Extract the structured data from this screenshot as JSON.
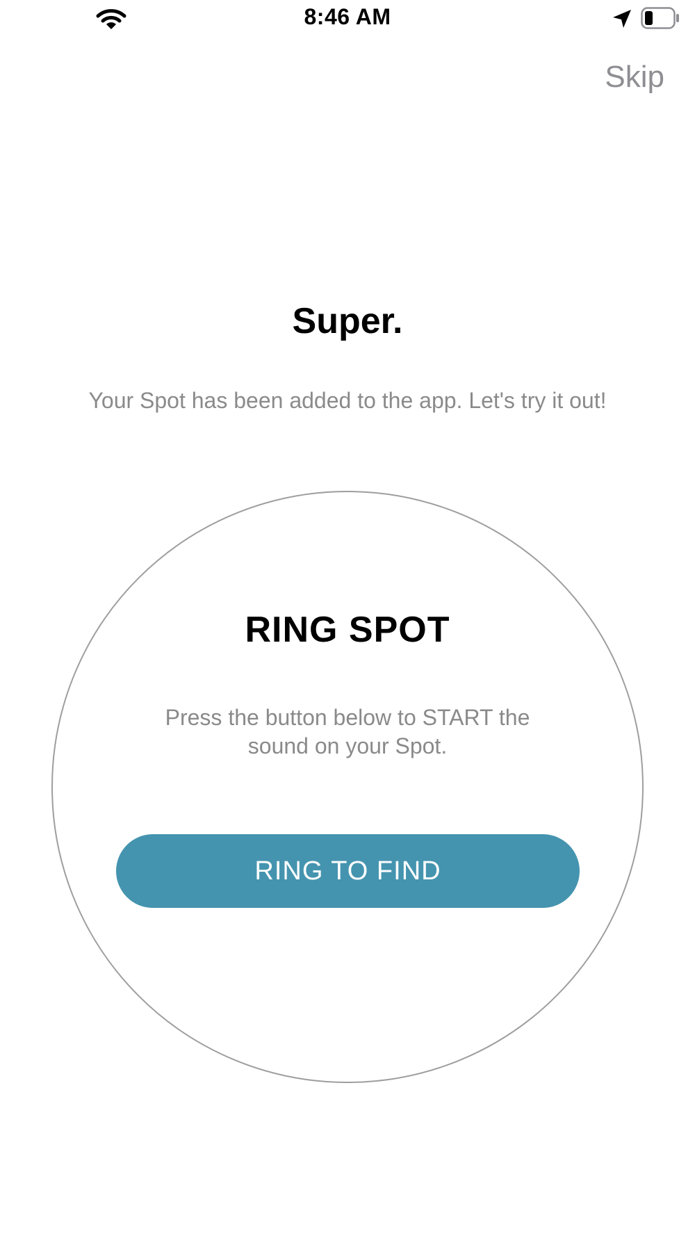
{
  "status_bar": {
    "time": "8:46 AM",
    "wifi_icon": "wifi-icon",
    "location_icon": "location-arrow-icon",
    "battery_icon": "battery-icon",
    "battery_level": 0.25
  },
  "header": {
    "skip_label": "Skip"
  },
  "main": {
    "title": "Super.",
    "subtitle": "Your Spot has been added to the app. Let's try it out!",
    "ring_card": {
      "title": "RING SPOT",
      "description": "Press the button below to START the sound on your Spot.",
      "button_label": "RING TO FIND"
    }
  },
  "colors": {
    "accent": "#4594af",
    "secondary_text": "#8a8a8a",
    "skip_text": "#8e8e93",
    "circle_border": "#9e9e9e"
  }
}
